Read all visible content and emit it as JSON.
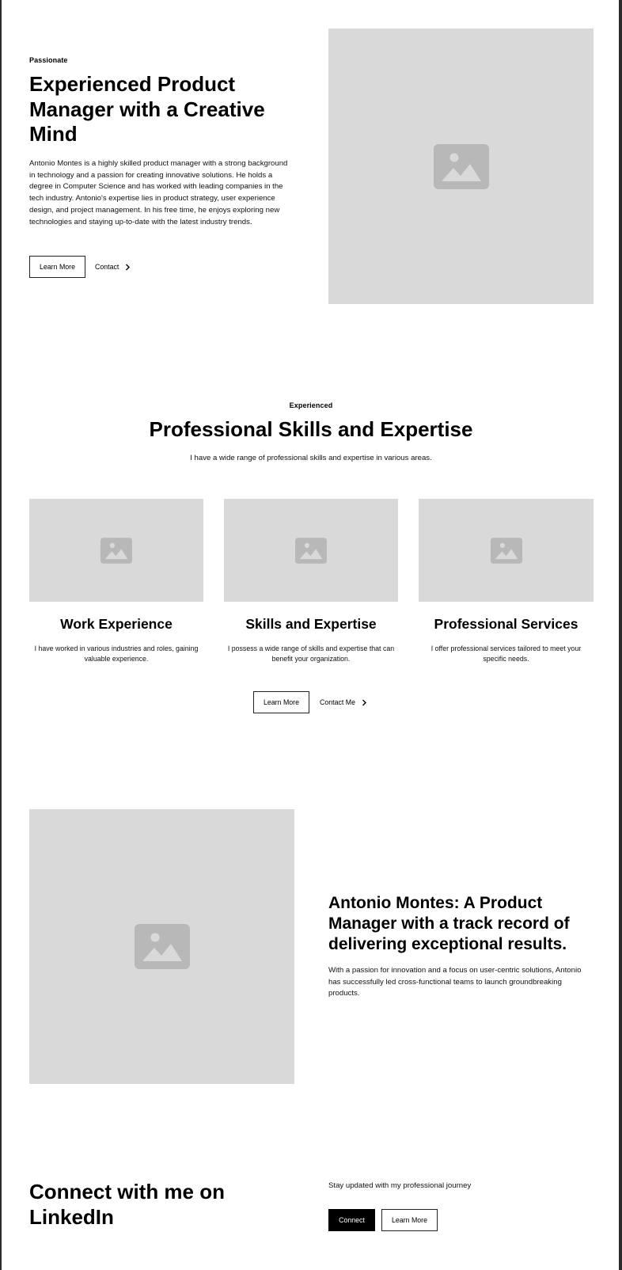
{
  "hero": {
    "tagline": "Passionate",
    "title": "Experienced Product Manager with a Creative Mind",
    "body": "Antonio Montes is a highly skilled product manager with a strong background in technology and a passion for creating innovative solutions. He holds a degree in Computer Science and has worked with leading companies in the tech industry. Antonio's expertise lies in product strategy, user experience design, and project management. In his free time, he enjoys exploring new technologies and staying up-to-date with the latest industry trends.",
    "primary_button": "Learn More",
    "secondary_link": "Contact"
  },
  "skills": {
    "tagline": "Experienced",
    "title": "Professional Skills and Expertise",
    "subtitle": "I have a wide range of professional skills and expertise in various areas.",
    "cards": [
      {
        "title": "Work Experience",
        "text": "I have worked in various industries and roles, gaining valuable experience."
      },
      {
        "title": "Skills and Expertise",
        "text": "I possess a wide range of skills and expertise that can benefit your organization."
      },
      {
        "title": "Professional Services",
        "text": "I offer professional services tailored to meet your specific needs."
      }
    ],
    "primary_button": "Learn More",
    "secondary_link": "Contact Me"
  },
  "about": {
    "title": "Antonio Montes: A Product Manager with a track record of delivering exceptional results.",
    "body": "With a passion for innovation and a focus on user-centric solutions, Antonio has successfully led cross-functional teams to launch groundbreaking products."
  },
  "cta": {
    "title": "Connect with me on LinkedIn",
    "subtitle": "Stay updated with my professional journey",
    "primary_button": "Connect",
    "secondary_button": "Learn More"
  },
  "icons": {
    "image": "image-placeholder-icon",
    "chevron": "chevron-right-icon"
  },
  "colors": {
    "placeholder_bg": "#d9d9d9",
    "placeholder_icon": "#b8b8b8",
    "accent": "#000000"
  }
}
